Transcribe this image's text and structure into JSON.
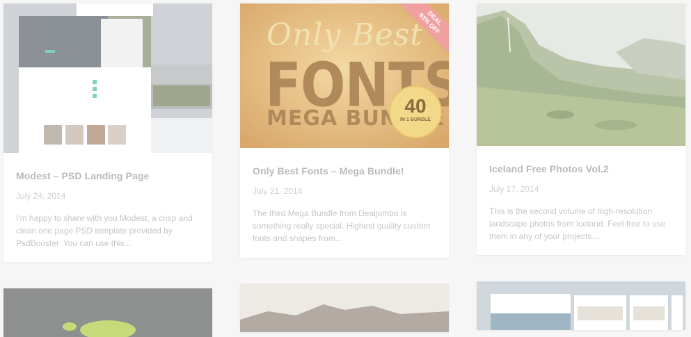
{
  "posts": [
    {
      "title": "Modest – PSD Landing Page",
      "date": "July 24, 2014",
      "excerpt": "I'm happy to share with you Modest, a crisp and clean one page PSD template provided by PsdBooster. You can use this..."
    },
    {
      "title": "Only Best Fonts – Mega Bundle!",
      "date": "July 21, 2014",
      "excerpt": "The third Mega Bundle from Dealjumbo is something really special. Highest quality custom fonts and shapes from...",
      "thumb": {
        "script": "Only Best",
        "big": "FONTS",
        "mega": "MEGA BUNDLE",
        "count": "40",
        "count_sub": "IN 1 BUNDLE",
        "deal_line1": "DEAL",
        "deal_line2": "93% OFF"
      }
    },
    {
      "title": "Iceland Free Photos Vol.2",
      "date": "July 17, 2014",
      "excerpt": "This is the second volume of high-resolution landscape photos from Iceland. Feel free to use them in any of your projects..."
    }
  ],
  "colors": {
    "background": "#f6f6f6",
    "card": "#ffffff",
    "title": "#b9b9b9",
    "meta": "#cfcfcf",
    "deal_badge": "#f0a0a0"
  }
}
